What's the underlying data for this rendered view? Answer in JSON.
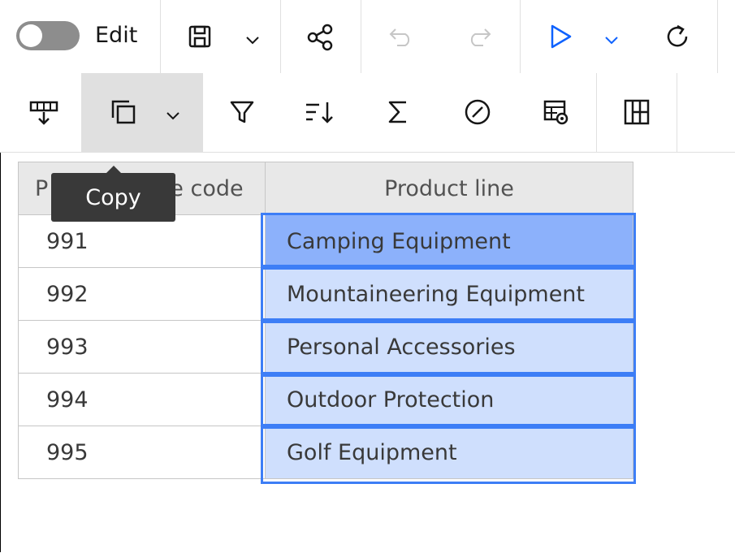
{
  "toolbar": {
    "edit_label": "Edit",
    "edit_toggle_on": false,
    "icons_row1": [
      "save-icon",
      "chevron-down-icon",
      "share-icon",
      "undo-icon",
      "redo-icon",
      "run-icon",
      "chevron-down-icon",
      "refresh-icon"
    ],
    "icons_row2": [
      "insert-row-icon",
      "copy-icon",
      "chevron-down-icon",
      "filter-icon",
      "sort-icon",
      "summarize-icon",
      "compass-icon",
      "table-settings-icon",
      "grid-icon"
    ],
    "accent_color": "#0f62fe"
  },
  "tooltip": {
    "text": "Copy"
  },
  "table": {
    "columns": [
      "Product line code",
      "Product line"
    ],
    "header_c1_visible": "P",
    "header_c1_tail": "e code",
    "rows": [
      {
        "code": "991",
        "line": "Camping Equipment"
      },
      {
        "code": "992",
        "line": "Mountaineering Equipment"
      },
      {
        "code": "993",
        "line": "Personal Accessories"
      },
      {
        "code": "994",
        "line": "Outdoor Protection"
      },
      {
        "code": "995",
        "line": "Golf Equipment"
      }
    ],
    "selection_color": "#3d7ef6"
  }
}
